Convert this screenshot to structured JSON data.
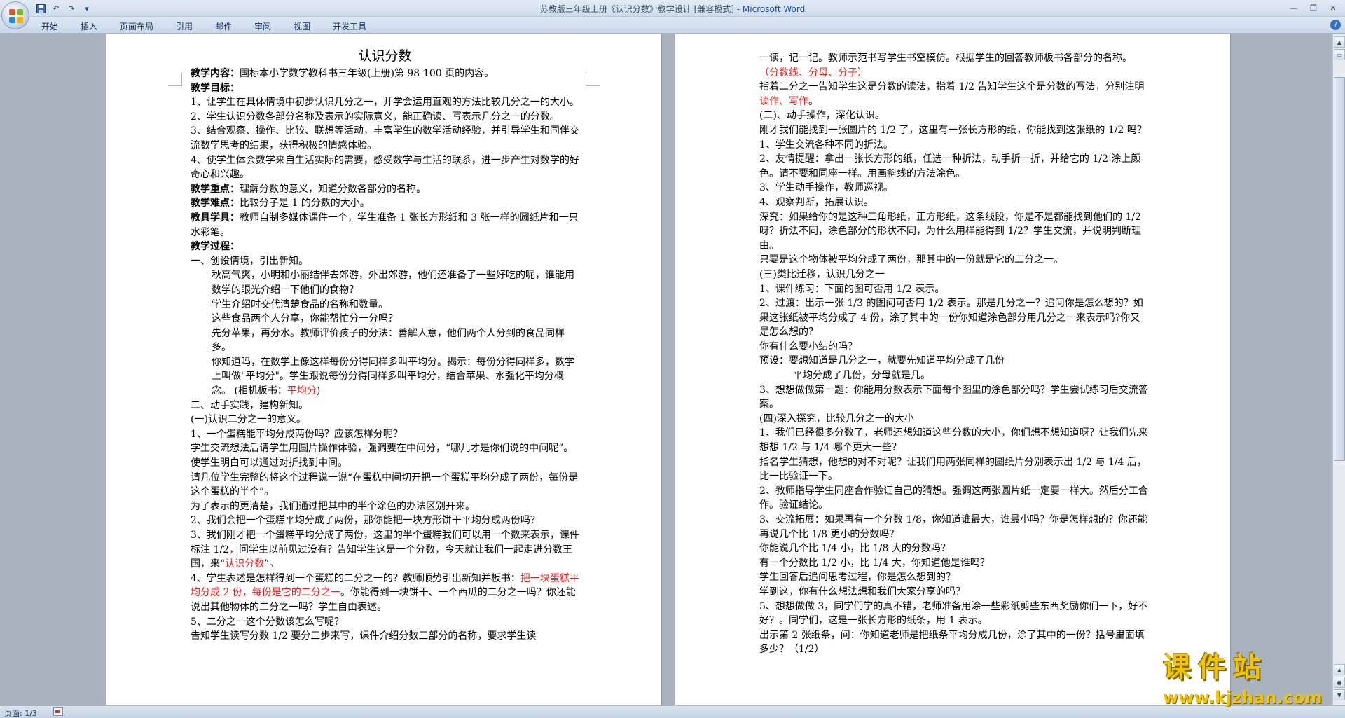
{
  "window": {
    "title": "苏教版三年级上册《认识分数》教学设计 [兼容模式] - ",
    "app_name": "Microsoft Word",
    "qat": [
      "save-icon",
      "undo-icon",
      "redo-icon",
      "customize-icon"
    ]
  },
  "ribbon": {
    "tabs": [
      "开始",
      "插入",
      "页面布局",
      "引用",
      "邮件",
      "审阅",
      "视图",
      "开发工具"
    ]
  },
  "status": {
    "page": "页面: 1/3"
  },
  "watermark": {
    "logo": "课件站",
    "url": "www.kjzhan.com"
  },
  "page1": {
    "title": "认识分数",
    "p1_label": "教学内容：",
    "p1_text": "国标本小学数学教科书三年级(上册)第 98-100 页的内容。",
    "p2_label": "教学目标：",
    "p3": "1、让学生在具体情境中初步认识几分之一，并学会运用直观的方法比较几分之一的大小。",
    "p4": "2、学生认识分数各部分名称及表示的实际意义，能正确读、写表示几分之一的分数。",
    "p5": "3、结合观察、操作、比较、联想等活动，丰富学生的数学活动经验，并引导学生和同伴交流数学思考的结果，获得积极的情感体验。",
    "p6": "4、使学生体会数学来自生活实际的需要，感受数学与生活的联系，进一步产生对数学的好奇心和兴趣。",
    "p7_label": "教学重点：",
    "p7_text": "理解分数的意义，知道分数各部分的名称。",
    "p8_label": "教学难点：",
    "p8_text": "比较分子是 1 的分数的大小。",
    "p9_label": "教具学具：",
    "p9_text": "教师自制多媒体课件一个，学生准备 1 张长方形纸和 3 张一样的圆纸片和一只水彩笔。",
    "p10_label": "教学过程：",
    "p11": "一、创设情境，引出新知。",
    "p12": "秋高气爽，小明和小丽结伴去郊游，外出郊游，他们还准备了一些好吃的呢，谁能用数学的眼光介绍一下他们的食物？",
    "p13": "学生介绍时交代清楚食品的名称和数量。",
    "p14": "这些食品两个人分享，你能帮忙分一分吗？",
    "p15": "先分苹果，再分水。教师评价孩子的分法：善解人意，他们两个人分到的食品同样多。",
    "p16_a": "你知道吗，在数学上像这样每份分得同样多叫平均分。揭示：每份分得同样多，数学上叫做\"平均分\"。学生跟说每份分得同样多叫平均分，结合苹果、水强化平均分概念。      (相机板书：",
    "p16_red": "平均分",
    "p16_b": ")",
    "p17": "二、动手实践，建构新知。",
    "p18": "(一)认识二分之一的意义。",
    "p19": "1、一个蛋糕能平均分成两份吗？应该怎样分呢？",
    "p20": "学生交流想法后请学生用圆片操作体验，强调要在中间分，“哪儿才是你们说的中间呢”。使学生明白可以通过对折找到中间。",
    "p21": "请几位学生完整的将这个过程说一说“在蛋糕中间切开把一个蛋糕平均分成了两份，每份是这个蛋糕的半个”。",
    "p22": "为了表示的更清楚，我们通过把其中的半个涂色的办法区别开来。",
    "p23": "2、我们会把一个蛋糕平均分成了两份，那你能把一块方形饼干平均分成两份吗？",
    "p24_a": "3、我们刚才把一个蛋糕平均分成了两份，这里的半个蛋糕我们可以用一个数来表示，课件标注 1/2，问学生以前见过没有？告知学生这是一个分数，今天就让我们一起走进分数王国，来“",
    "p24_red": "认识分数",
    "p24_b": "”。",
    "p25_a": "4、学生表述是怎样得到一个蛋糕的二分之一的？教师顺势引出新知并板书：",
    "p25_red": "把一块蛋糕平均分成 2 份，每份是它的二分之一",
    "p25_b": "。你能得到一块饼干、一个西瓜的二分之一吗？你还能说出其他物体的二分之一吗？学生自由表述。",
    "p26": "5、二分之一这个分数该怎么写呢？",
    "p27": "告知学生读写分数 1/2 要分三步来写，课件介绍分数三部分的名称，要求学生读"
  },
  "page2": {
    "q1": "一读，记一记。教师示范书写学生书空模仿。根据学生的回答教师板书各部分的名称。",
    "q2_red": "（分数线、分母、分子）",
    "q3_a": "指着二分之一告知学生这是分数的读法，指着 1/2 告知学生这个是分数的写法，分别注明",
    "q3_red1": "读作",
    "q3_sep": "、",
    "q3_red2": "写作",
    "q3_b": "。",
    "q4": " (二)、动手操作，深化认识。",
    "q5": "刚才我们能找到一张圆片的 1/2 了，这里有一张长方形的纸，你能找到这张纸的 1/2 吗？",
    "q6": "1、学生交流各种不同的折法。",
    "q7": "2、友情提醒：拿出一张长方形的纸，任选一种折法，动手折一折，并给它的 1/2 涂上颜色。请不要和同座一样。用画斜线的方法涂色。",
    "q8": "3、学生动手操作，教师巡视。",
    "q9": "4、观察判断，拓展认识。",
    "q10": "深究：如果给你的是这种三角形纸，正方形纸，这条线段，你是不是都能找到他们的 1/2 呀？折法不同，涂色部分的形状不同，为什么用样能得到 1/2？学生交流，并说明判断理由。",
    "q11": "只要是这个物体被平均分成了两份，那其中的一份就是它的二分之一。",
    "q12": "(三)类比迁移，认识几分之一",
    "q13": "1、课件练习：下面的图可否用 1/2 表示。",
    "q14": "2、过渡：出示一张 1/3 的图问可否用 1/2 表示。那是几分之一？追问你是怎么想的？如果这张纸被平均分成了 4 份，涂了其中的一份你知道涂色部分用几分之一来表示吗?你又是怎么想的？",
    "q15": "你有什么要小结的吗？",
    "q16": "预设：要想知道是几分之一，就要先知道平均分成了几份",
    "q17": "平均分成了几份，分母就是几。",
    "q18": "3、想想做做第一题：你能用分数表示下面每个图里的涂色部分吗？学生尝试练习后交流答案。",
    "q19": "(四)深入探究，比较几分之一的大小",
    "q20": "1、我们已经很多分数了，老师还想知道这些分数的大小，你们想不想知道呀？让我们先来想想 1/2 与 1/4 哪个更大一些？",
    "q21": "指名学生猜想，他想的对不对呢？让我们用两张同样的圆纸片分别表示出 1/2 与 1/4 后，比一比验证一下。",
    "q22": "2、教师指导学生同座合作验证自己的猜想。强调这两张圆片纸一定要一样大。然后分工合作。验证结论。",
    "q23": "3、交流拓展：如果再有一个分数 1/8，你知道谁最大，谁最小吗？你是怎样想的？你还能再说几个比 1/8 更小的分数吗？",
    "q24": "你能说几个比 1/4 小，比 1/8 大的分数吗？",
    "q25": "有一个分数比 1/2 小，比 1/4 大，你知道他是谁吗？",
    "q26": "学生回答后追问思考过程，你是怎么想到的？",
    "q27": "学到这，你有什么想法想和我们大家分享的吗？",
    "q28": "5、想想做做 3，同学们学的真不错，老师准备用涂一些彩纸剪些东西奖励你们一下，好不好？。同学们，这是一张长方形的纸条，用 1 表示。",
    "q29": "出示第 2 张纸条，问：你知道老师是把纸条平均分成几份，涂了其中的一份？括号里面填多少？（1/2）"
  }
}
